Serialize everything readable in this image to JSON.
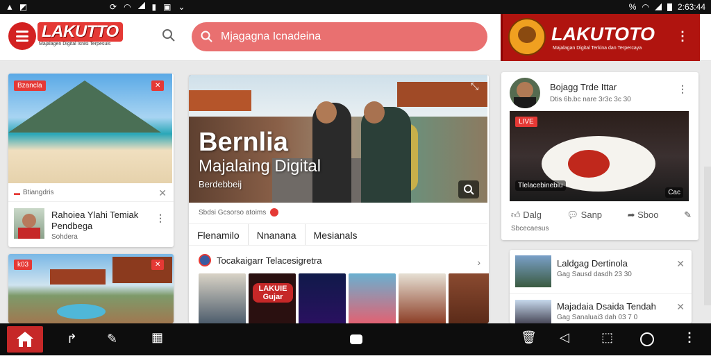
{
  "status_bar": {
    "left_icons": [
      "a-icon",
      "image-icon"
    ],
    "center_icons": [
      "sync-icon",
      "wifi-icon",
      "signal-icon",
      "sim-icon",
      "screenshot-icon",
      "chevron-down-icon"
    ],
    "battery_percent": "%",
    "time": "2:63:44"
  },
  "header": {
    "logo": "LAKUTTO",
    "logo_tagline": "Majalagen Digital Isnisi Terpesuis",
    "search_placeholder": "Mjagagna Icnadeina",
    "promo": {
      "title": "LAKUTOTO",
      "subtitle": "Majalagan Digital Terkina dan Terpercaya"
    }
  },
  "left_column": {
    "card1": {
      "image_tag": "Bzancla",
      "meta": "Btiangdris",
      "title": "Rahoiea Ylahi Temiak Pendbega",
      "subtitle": "Sohdera"
    },
    "card2": {
      "image_tag": "k03"
    }
  },
  "main": {
    "hero_title": "Bernlia",
    "hero_subtitle": "Majalaing Digital",
    "hero_caption": "Berdebbeij",
    "meta_line": "Sbdsi Gcsorso atoims",
    "tabs": [
      "Flenamilo",
      "Nnanana",
      "Mesianals"
    ],
    "section_title": "Tocakaigarr Telacesigretra",
    "thumb_label": "LAKUIE Gujar"
  },
  "right_column": {
    "post": {
      "author": "Bojagg Trde Ittar",
      "date": "Dtis 6b.bc nare 3r3c 3c 30",
      "image_tag_top": "LIVE",
      "image_caption": "Tlelacebinebiu",
      "image_badge": "Cac",
      "actions": [
        "Dalg",
        "Sanp",
        "Sboo",
        ""
      ],
      "footer": "Sbcecaesus"
    },
    "list": [
      {
        "title": "Laldgag Dertinola",
        "meta": "Gag Sausd dasdh 23 30"
      },
      {
        "title": "Majadaia Dsaida Tendah",
        "meta": "Gag Sanaluai3 dah 03 7 0"
      }
    ]
  },
  "colors": {
    "brand_red": "#d32121",
    "search_bg": "#e97070",
    "promo_bg": "#b0140f"
  }
}
